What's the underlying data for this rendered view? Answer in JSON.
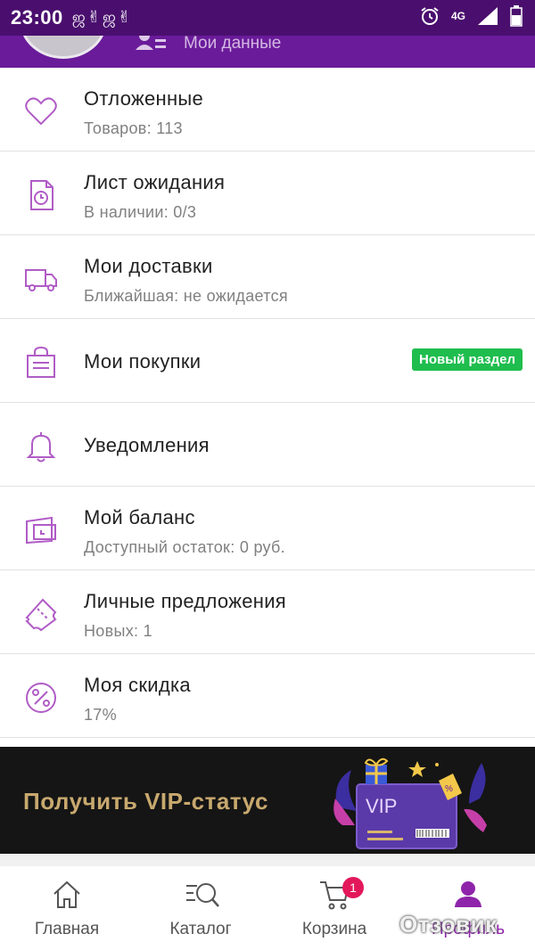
{
  "status_bar": {
    "time": "23:00",
    "notifications": "ஜ✌ஜ✌",
    "network": "4G"
  },
  "header": {
    "my_data_label": "Мои данные"
  },
  "menu": [
    {
      "title": "Отложенные",
      "subtitle": "Товаров: 113",
      "icon": "heart-icon"
    },
    {
      "title": "Лист ожидания",
      "subtitle": "В наличии: 0/3",
      "icon": "waitlist-clock-icon"
    },
    {
      "title": "Мои доставки",
      "subtitle": "Ближайшая: не ожидается",
      "icon": "truck-icon"
    },
    {
      "title": "Мои покупки",
      "badge": "Новый раздел",
      "icon": "shopping-bag-icon"
    },
    {
      "title": "Уведомления",
      "icon": "bell-icon"
    },
    {
      "title": "Мой баланс",
      "subtitle": "Доступный остаток: 0 руб.",
      "icon": "wallet-icon"
    },
    {
      "title": "Личные предложения",
      "subtitle": "Новых: 1",
      "icon": "ticket-icon"
    },
    {
      "title": "Моя скидка",
      "subtitle": "17%",
      "icon": "percent-icon"
    }
  ],
  "vip_banner": {
    "text": "Получить VIP-статус",
    "card_label": "VIP",
    "tag_label": "%"
  },
  "bottom_nav": {
    "items": [
      {
        "label": "Главная",
        "icon": "home-icon"
      },
      {
        "label": "Каталог",
        "icon": "catalog-search-icon"
      },
      {
        "label": "Корзина",
        "icon": "cart-icon",
        "badge": "1"
      },
      {
        "label": "Профиль",
        "icon": "profile-icon"
      }
    ]
  },
  "watermark": "Отзовик",
  "colors": {
    "accent": "#8e24aa",
    "header": "#6a1b9a",
    "badge_green": "#1fbd4e",
    "vip_gold": "#c8a96e"
  }
}
